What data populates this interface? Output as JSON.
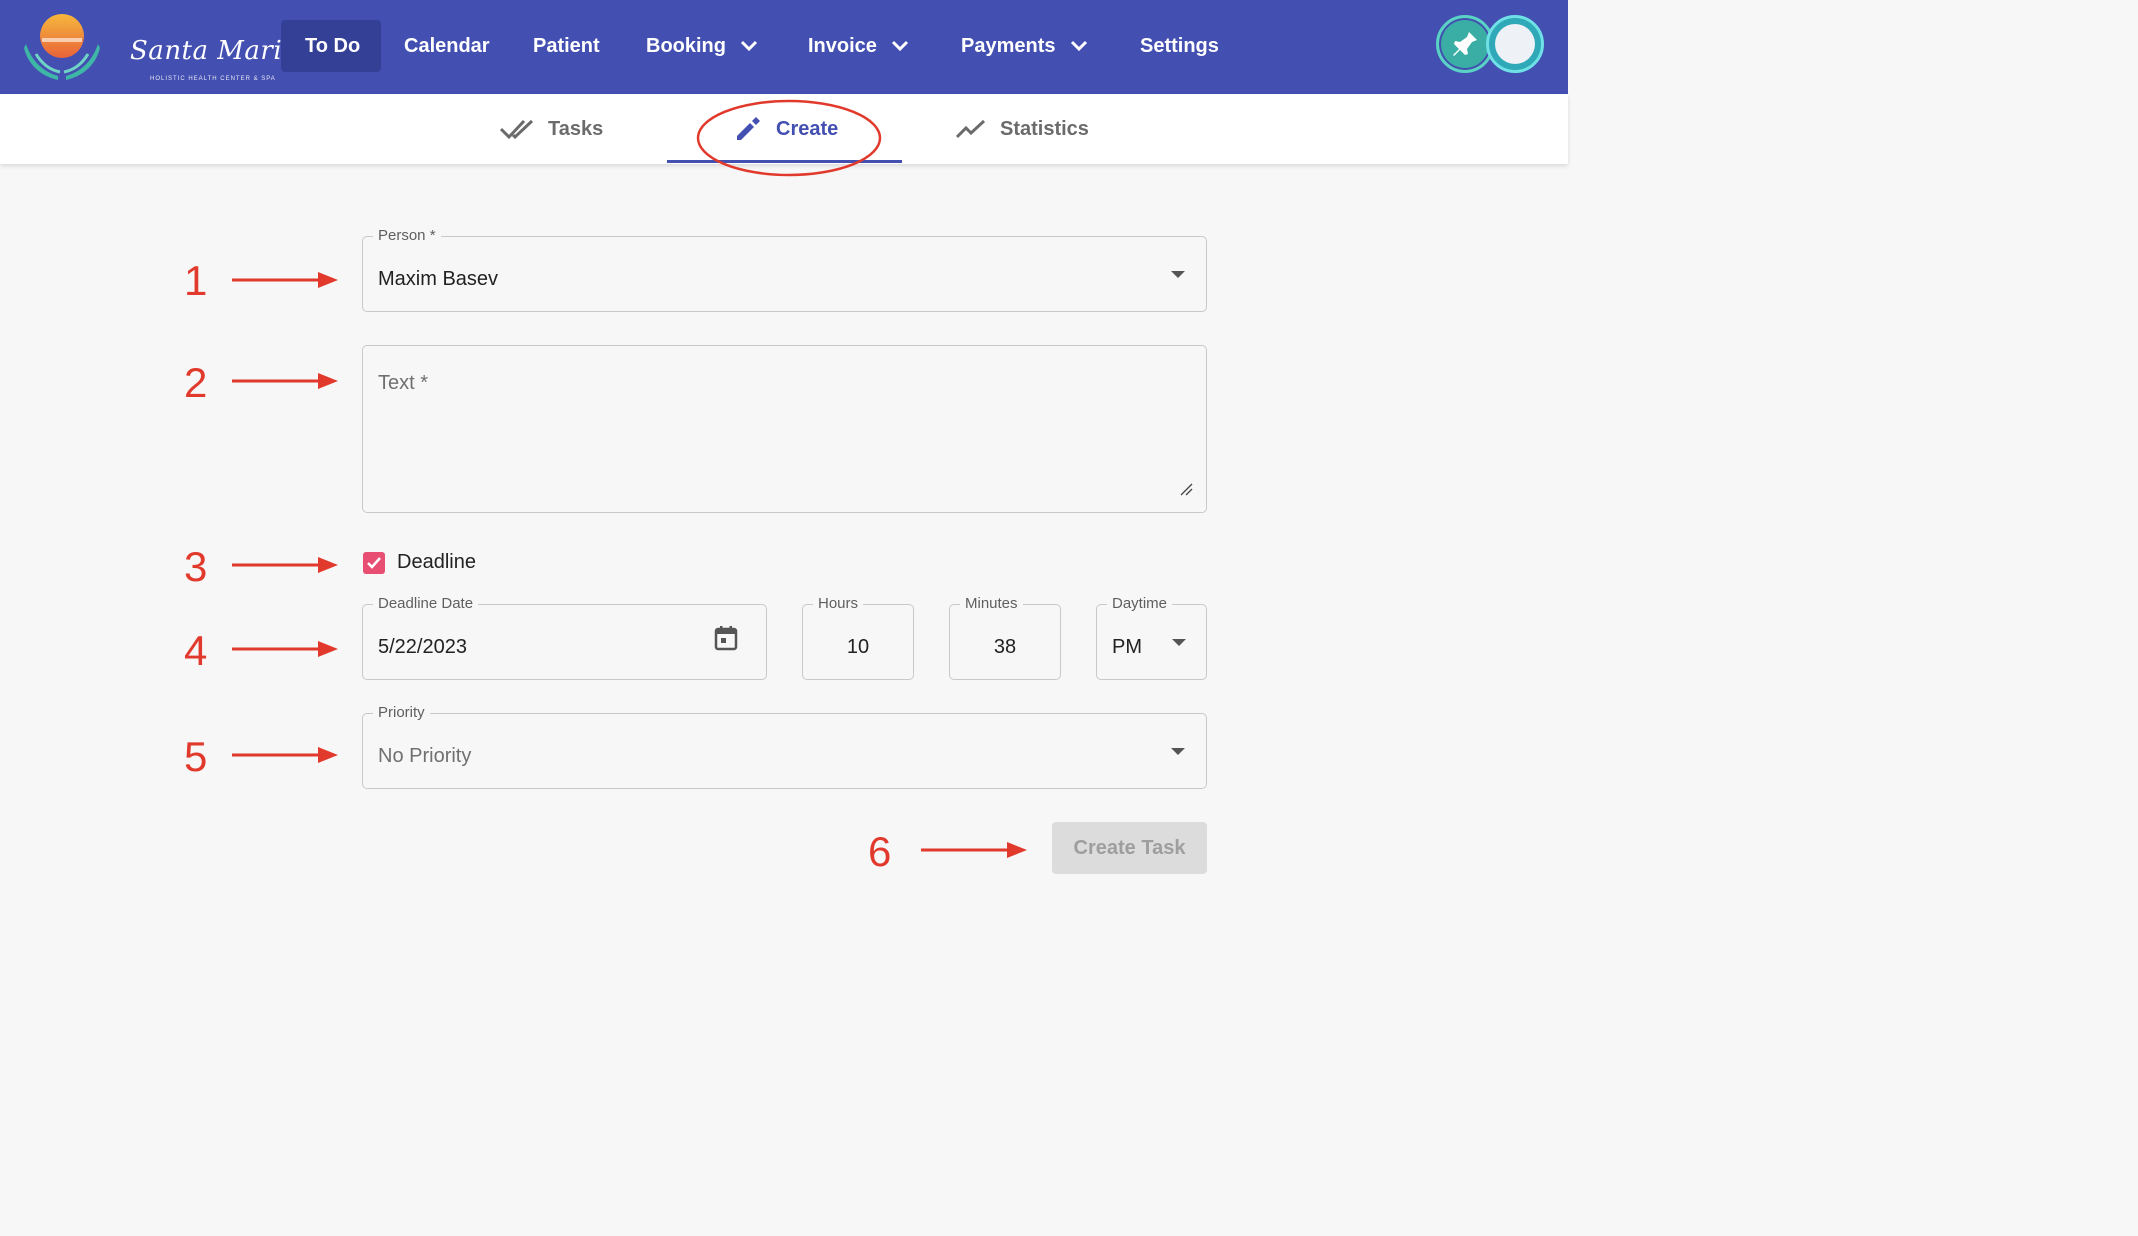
{
  "brand": {
    "name": "Santa Maria",
    "tagline": "HOLISTIC HEALTH CENTER & SPA"
  },
  "nav": {
    "todo": "To Do",
    "calendar": "Calendar",
    "patient": "Patient",
    "booking": "Booking",
    "invoice": "Invoice",
    "payments": "Payments",
    "settings": "Settings"
  },
  "tabs": {
    "tasks": "Tasks",
    "create": "Create",
    "statistics": "Statistics"
  },
  "form": {
    "person_label": "Person *",
    "person_value": "Maxim Basev",
    "text_placeholder": "Text *",
    "deadline_label": "Deadline",
    "deadline_checked": true,
    "deadline_date_label": "Deadline Date",
    "deadline_date_value": "5/22/2023",
    "hours_label": "Hours",
    "hours_value": "10",
    "minutes_label": "Minutes",
    "minutes_value": "38",
    "daytime_label": "Daytime",
    "daytime_value": "PM",
    "priority_label": "Priority",
    "priority_value": "No Priority",
    "submit_label": "Create Task"
  },
  "annotations": [
    "1",
    "2",
    "3",
    "4",
    "5",
    "6"
  ],
  "colors": {
    "navbar": "#434fb1",
    "accent": "#434fb1",
    "checkbox": "#e84d72",
    "annotation": "#e13a2c"
  }
}
